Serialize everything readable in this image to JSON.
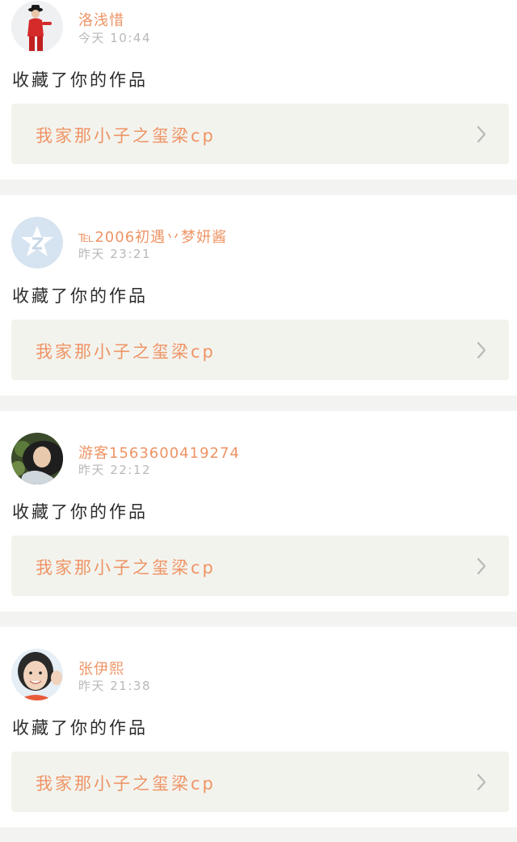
{
  "notifications": [
    {
      "user_name": "洛浅惜",
      "timestamp": "今天 10:44",
      "action": "收藏了你的作品",
      "work_title": "我家那小子之玺梁cp",
      "avatar_icon": "photo-avatar-red-outfit"
    },
    {
      "user_name": "℡2006初遇丷梦妍酱",
      "timestamp": "昨天 23:21",
      "action": "收藏了你的作品",
      "work_title": "我家那小子之玺梁cp",
      "avatar_icon": "qq-default-avatar"
    },
    {
      "user_name": "游客1563600419274",
      "timestamp": "昨天 22:12",
      "action": "收藏了你的作品",
      "work_title": "我家那小子之玺梁cp",
      "avatar_icon": "photo-avatar-girl-lying"
    },
    {
      "user_name": "张伊熙",
      "timestamp": "昨天 21:38",
      "action": "收藏了你的作品",
      "work_title": "我家那小子之玺梁cp",
      "avatar_icon": "photo-avatar-girl-smiling"
    }
  ],
  "colors": {
    "accent": "#ee9465",
    "background": "#f3f3f1",
    "card": "#ffffff",
    "link_box": "#f3f3ee",
    "timestamp": "#b9b9b9"
  }
}
